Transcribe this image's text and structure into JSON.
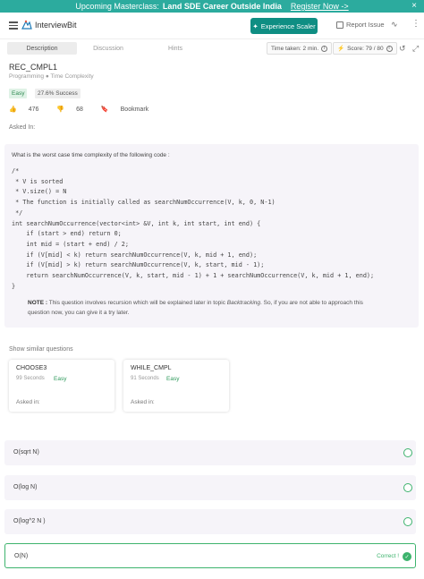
{
  "banner": {
    "text_prefix": "Upcoming Masterclass:",
    "text_bold": "Land SDE Career Outside India",
    "link": "Register Now ->",
    "close": "×"
  },
  "header": {
    "logo_text": "InterviewBit",
    "experience_button": "Experience Scaler",
    "report_issue": "Report Issue"
  },
  "tabs": [
    {
      "label": "Description"
    },
    {
      "label": "Discussion"
    },
    {
      "label": "Hints"
    }
  ],
  "stats": {
    "time_taken": "Time taken: 2 min.",
    "score": "Score: 79 / 80"
  },
  "problem": {
    "title": "REC_CMPL1",
    "breadcrumb": "Programming ● Time Complexity",
    "difficulty": "Easy",
    "success": "27.6% Success",
    "likes": "476",
    "dislikes": "68",
    "bookmark": "Bookmark",
    "asked_in": "Asked In:"
  },
  "question": {
    "text": "What is the worst case time complexity of the following code :",
    "code": "/*\n * V is sorted\n * V.size() = N\n * The function is initially called as searchNumOccurrence(V, k, 0, N-1)\n */\nint searchNumOccurrence(vector<int> &V, int k, int start, int end) {\n    if (start > end) return 0;\n    int mid = (start + end) / 2;\n    if (V[mid] < k) return searchNumOccurrence(V, k, mid + 1, end);\n    if (V[mid] > k) return searchNumOccurrence(V, k, start, mid - 1);\n    return searchNumOccurrence(V, k, start, mid - 1) + 1 + searchNumOccurrence(V, k, mid + 1, end);\n}",
    "note_label": "NOTE :",
    "note_text_1": " This question involves recursion which will be explained later in topic ",
    "note_topic": "Backtracking",
    "note_text_2": ". So, if you are not able to approach this question now, you can give it a try later."
  },
  "similar": {
    "heading": "Show similar questions",
    "cards": [
      {
        "name": "CHOOSE3",
        "seconds": "99 Seconds",
        "level": "Easy",
        "asked": "Asked in:"
      },
      {
        "name": "WHILE_CMPL",
        "seconds": "91 Seconds",
        "level": "Easy",
        "asked": "Asked in:"
      }
    ]
  },
  "options": [
    {
      "label": "O(sqrt N)",
      "selected": false
    },
    {
      "label": "O(log N)",
      "selected": false
    },
    {
      "label": "O(log^2 N )",
      "selected": false
    },
    {
      "label": "O(N)",
      "selected": true,
      "tag": "Correct !"
    }
  ],
  "colors": {
    "brand": "#2cab9e",
    "primary_button": "#0f8e83",
    "correct": "#3db36d",
    "question_bg": "#f6f4f9"
  }
}
